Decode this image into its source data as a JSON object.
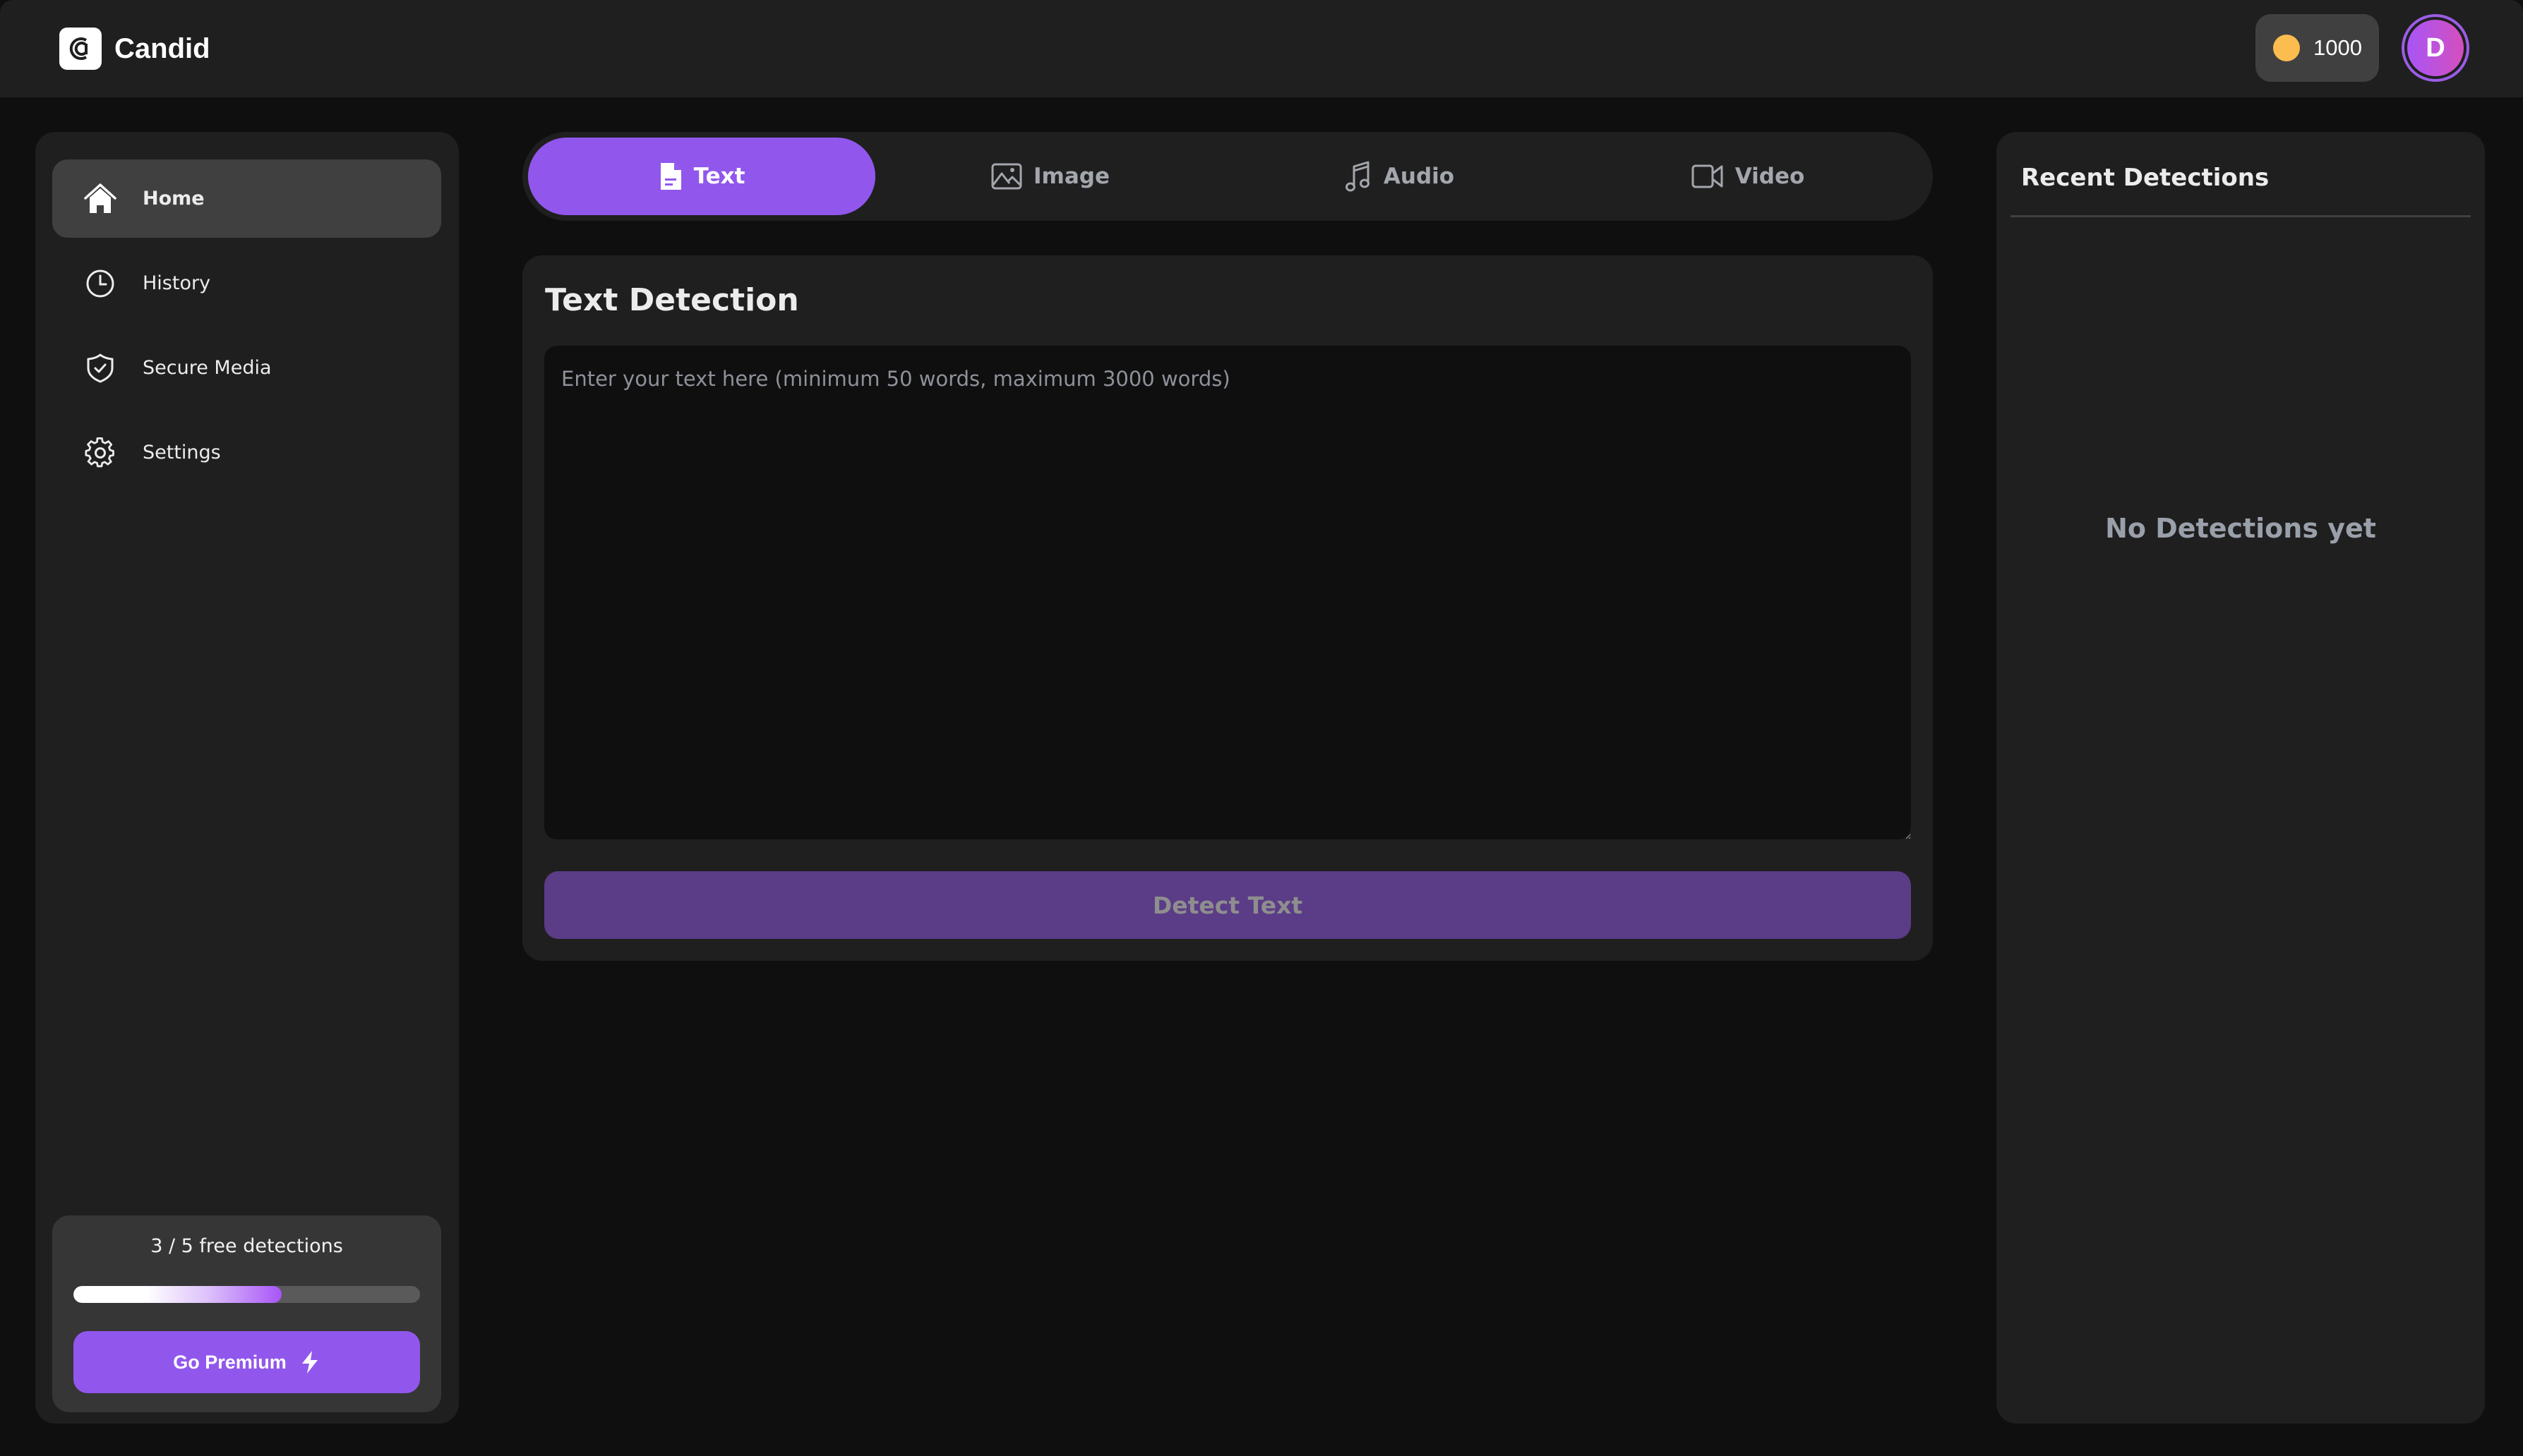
{
  "app": {
    "name": "Candid",
    "credits": "1000",
    "avatar_initial": "D",
    "accent_color": "#9157ec"
  },
  "sidebar": {
    "items": [
      {
        "label": "Home",
        "icon": "home-icon",
        "active": true
      },
      {
        "label": "History",
        "icon": "clock-icon",
        "active": false
      },
      {
        "label": "Secure Media",
        "icon": "shield-check-icon",
        "active": false
      },
      {
        "label": "Settings",
        "icon": "gear-icon",
        "active": false
      }
    ],
    "usage": {
      "text": "3 / 5 free detections",
      "used": 3,
      "total": 5,
      "progress_fraction": 0.6
    },
    "premium_label": "Go Premium"
  },
  "tabs": [
    {
      "label": "Text",
      "icon": "document-icon",
      "active": true
    },
    {
      "label": "Image",
      "icon": "image-icon",
      "active": false
    },
    {
      "label": "Audio",
      "icon": "music-note-icon",
      "active": false
    },
    {
      "label": "Video",
      "icon": "video-camera-icon",
      "active": false
    }
  ],
  "detection": {
    "title": "Text Detection",
    "input_value": "",
    "input_placeholder": "Enter your text here (minimum 50 words, maximum 3000 words)",
    "button_label": "Detect Text"
  },
  "recent": {
    "title": "Recent Detections",
    "empty_text": "No Detections yet"
  }
}
